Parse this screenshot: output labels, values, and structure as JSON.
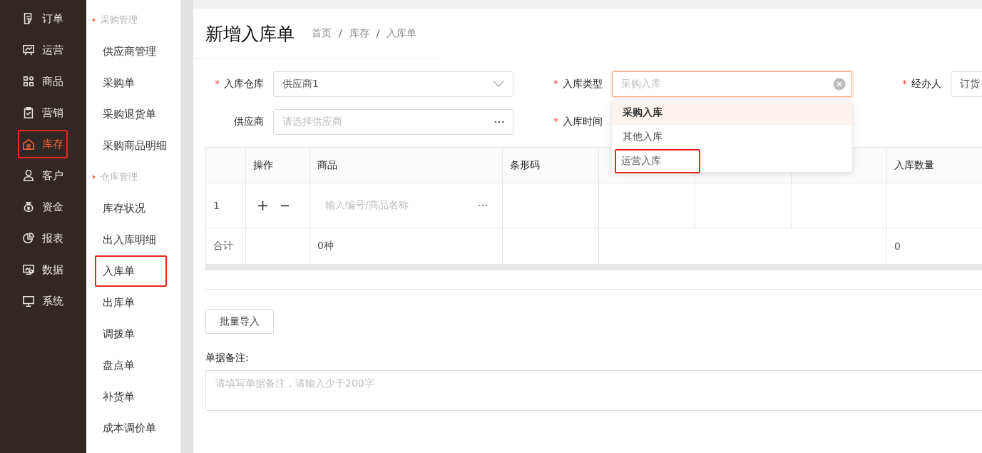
{
  "sidebar": {
    "items": [
      {
        "label": "订单",
        "selected": false,
        "highlighted": false
      },
      {
        "label": "运营",
        "selected": false,
        "highlighted": false
      },
      {
        "label": "商品",
        "selected": false,
        "highlighted": false
      },
      {
        "label": "营销",
        "selected": false,
        "highlighted": false
      },
      {
        "label": "库存",
        "selected": true,
        "highlighted": true
      },
      {
        "label": "客户",
        "selected": false,
        "highlighted": false
      },
      {
        "label": "资金",
        "selected": false,
        "highlighted": false
      },
      {
        "label": "报表",
        "selected": false,
        "highlighted": false
      },
      {
        "label": "数据",
        "selected": false,
        "highlighted": false
      },
      {
        "label": "系统",
        "selected": false,
        "highlighted": false
      }
    ]
  },
  "subnav": {
    "groups": [
      {
        "title": "采购管理",
        "items": [
          {
            "label": "供应商管理",
            "highlighted": false
          },
          {
            "label": "采购单",
            "highlighted": false
          },
          {
            "label": "采购退货单",
            "highlighted": false
          },
          {
            "label": "采购商品明细",
            "highlighted": false
          }
        ]
      },
      {
        "title": "仓库管理",
        "items": [
          {
            "label": "库存状况",
            "highlighted": false
          },
          {
            "label": "出入库明细",
            "highlighted": false
          },
          {
            "label": "入库单",
            "highlighted": true
          },
          {
            "label": "出库单",
            "highlighted": false
          },
          {
            "label": "调拨单",
            "highlighted": false
          },
          {
            "label": "盘点单",
            "highlighted": false
          },
          {
            "label": "补货单",
            "highlighted": false
          },
          {
            "label": "成本调价单",
            "highlighted": false
          }
        ]
      }
    ]
  },
  "page": {
    "title": "新增入库单",
    "breadcrumb": [
      {
        "kind": "link",
        "text": "首页"
      },
      {
        "kind": "separator",
        "text": "/"
      },
      {
        "kind": "link",
        "text": "库存"
      },
      {
        "kind": "separator",
        "text": "/"
      },
      {
        "kind": "link",
        "text": "入库单"
      }
    ]
  },
  "form": {
    "fields": [
      {
        "label": "入库仓库",
        "required_mark": "*",
        "kind": "select",
        "value": "供应商1",
        "focused": false,
        "clearable": false
      },
      {
        "label": "入库类型",
        "required_mark": "*",
        "kind": "select",
        "placeholder": "采购入库",
        "focused": true,
        "clearable": true
      },
      {
        "label": "经办人",
        "required_mark": "*",
        "kind": "text",
        "value": "订货",
        "focused": false
      },
      {
        "label": "供应商",
        "kind": "picker",
        "placeholder": "请选择供应商",
        "focused": false
      },
      {
        "label": "入库时间",
        "required_mark": "*"
      }
    ]
  },
  "dropdown": {
    "options": [
      {
        "label": "采购入库",
        "selected": true,
        "highlighted": false
      },
      {
        "label": "其他入库",
        "selected": false,
        "highlighted": false
      },
      {
        "label": "运营入库",
        "selected": false,
        "highlighted": true
      }
    ]
  },
  "table": {
    "columns": [
      {},
      {
        "label": "操作"
      },
      {
        "label": "商品"
      },
      {
        "label": "条形码"
      },
      {},
      {},
      {},
      {
        "label": "入库数量"
      }
    ],
    "rows": [
      {
        "index": "1",
        "product_placeholder": "输入编号/商品名称"
      }
    ],
    "total": {
      "label": "合计",
      "product": "0种",
      "quantity": "0"
    }
  },
  "import_button": "批量导入",
  "remarks": {
    "label": "单据备注:",
    "placeholder": "请填写单据备注，请输入少于200字"
  }
}
